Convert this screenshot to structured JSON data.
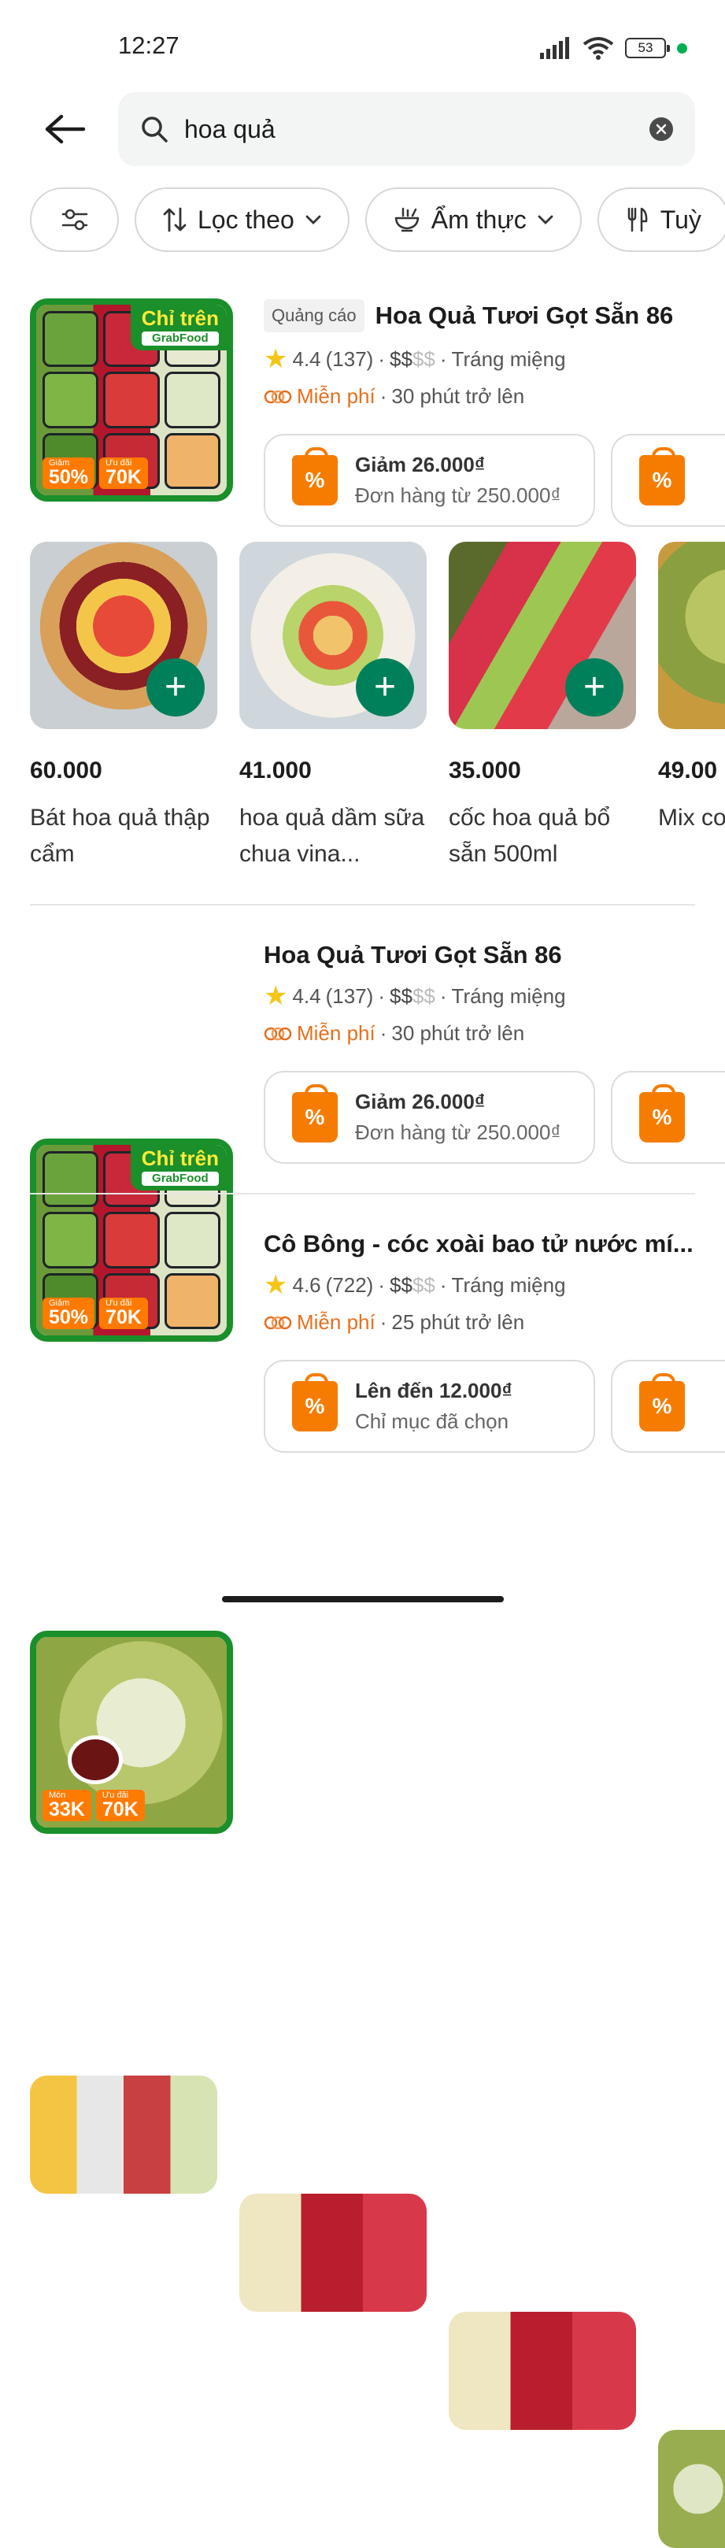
{
  "status_bar": {
    "time": "12:27",
    "battery": "53"
  },
  "search": {
    "query": "hoa quả"
  },
  "filters": [
    {
      "label": ""
    },
    {
      "label": "Lọc theo"
    },
    {
      "label": "Ẩm thực"
    },
    {
      "label": "Tuỳ"
    }
  ],
  "merchants": [
    {
      "ad_label": "Quảng cáo",
      "name": "Hoa Quả Tươi Gọt Sẵn 86",
      "rating": "4.4",
      "reviews": "(137)",
      "price_active": "$$",
      "price_muted": "$$",
      "category": "Tráng miệng",
      "delivery": "Miễn phí",
      "time": "30 phút trở lên",
      "thumb_tag": "Chỉ trên",
      "thumb_tag_sub": "GrabFood",
      "badge_1": "50%",
      "badge_1_label": "Giảm",
      "badge_2": "70K",
      "badge_2_label": "Ưu đãi",
      "offer_title": "Giảm 26.000₫",
      "offer_sub": "Đơn hàng từ 250.000₫",
      "items": [
        {
          "price": "60.000",
          "name": "Bát hoa quả thập cẩm"
        },
        {
          "price": "41.000",
          "name": "hoa quả dầm sữa chua vina..."
        },
        {
          "price": "35.000",
          "name": "cốc hoa quả bổ sẵn 500ml"
        },
        {
          "price": "49.00",
          "name": "Mix co lắc mu"
        }
      ]
    },
    {
      "name": "Hoa Quả Tươi Gọt Sẵn 86",
      "rating": "4.4",
      "reviews": "(137)",
      "price_active": "$$",
      "price_muted": "$$",
      "category": "Tráng miệng",
      "delivery": "Miễn phí",
      "time": "30 phút trở lên",
      "thumb_tag": "Chỉ trên",
      "thumb_tag_sub": "GrabFood",
      "badge_1": "50%",
      "badge_1_label": "Giảm",
      "badge_2": "70K",
      "badge_2_label": "Ưu đãi",
      "offer_title": "Giảm 26.000₫",
      "offer_sub": "Đơn hàng từ 250.000₫"
    },
    {
      "name": "Cô Bông - cóc xoài bao tử nước mí...",
      "rating": "4.6",
      "reviews": "(722)",
      "price_active": "$$",
      "price_muted": "$$",
      "category": "Tráng miệng",
      "delivery": "Miễn phí",
      "time": "25 phút trở lên",
      "badge_1": "33K",
      "badge_1_label": "Món",
      "badge_2": "70K",
      "badge_2_label": "Ưu đãi",
      "offer_title": "Lên đến 12.000₫",
      "offer_sub": "Chỉ mục đã chọn"
    }
  ],
  "colors": {
    "brand_green": "#00b14f",
    "button_green": "#00805a",
    "free_orange": "#e5701e",
    "offer_orange": "#f57c00"
  }
}
